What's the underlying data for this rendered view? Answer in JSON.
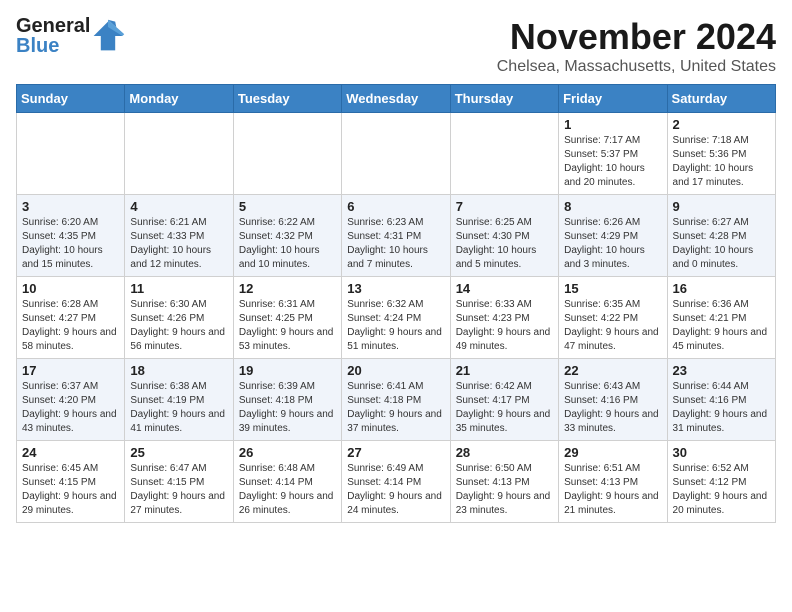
{
  "header": {
    "logo_general": "General",
    "logo_blue": "Blue",
    "month": "November 2024",
    "location": "Chelsea, Massachusetts, United States"
  },
  "days_of_week": [
    "Sunday",
    "Monday",
    "Tuesday",
    "Wednesday",
    "Thursday",
    "Friday",
    "Saturday"
  ],
  "weeks": [
    [
      {
        "day": "",
        "info": ""
      },
      {
        "day": "",
        "info": ""
      },
      {
        "day": "",
        "info": ""
      },
      {
        "day": "",
        "info": ""
      },
      {
        "day": "",
        "info": ""
      },
      {
        "day": "1",
        "info": "Sunrise: 7:17 AM\nSunset: 5:37 PM\nDaylight: 10 hours and 20 minutes."
      },
      {
        "day": "2",
        "info": "Sunrise: 7:18 AM\nSunset: 5:36 PM\nDaylight: 10 hours and 17 minutes."
      }
    ],
    [
      {
        "day": "3",
        "info": "Sunrise: 6:20 AM\nSunset: 4:35 PM\nDaylight: 10 hours and 15 minutes."
      },
      {
        "day": "4",
        "info": "Sunrise: 6:21 AM\nSunset: 4:33 PM\nDaylight: 10 hours and 12 minutes."
      },
      {
        "day": "5",
        "info": "Sunrise: 6:22 AM\nSunset: 4:32 PM\nDaylight: 10 hours and 10 minutes."
      },
      {
        "day": "6",
        "info": "Sunrise: 6:23 AM\nSunset: 4:31 PM\nDaylight: 10 hours and 7 minutes."
      },
      {
        "day": "7",
        "info": "Sunrise: 6:25 AM\nSunset: 4:30 PM\nDaylight: 10 hours and 5 minutes."
      },
      {
        "day": "8",
        "info": "Sunrise: 6:26 AM\nSunset: 4:29 PM\nDaylight: 10 hours and 3 minutes."
      },
      {
        "day": "9",
        "info": "Sunrise: 6:27 AM\nSunset: 4:28 PM\nDaylight: 10 hours and 0 minutes."
      }
    ],
    [
      {
        "day": "10",
        "info": "Sunrise: 6:28 AM\nSunset: 4:27 PM\nDaylight: 9 hours and 58 minutes."
      },
      {
        "day": "11",
        "info": "Sunrise: 6:30 AM\nSunset: 4:26 PM\nDaylight: 9 hours and 56 minutes."
      },
      {
        "day": "12",
        "info": "Sunrise: 6:31 AM\nSunset: 4:25 PM\nDaylight: 9 hours and 53 minutes."
      },
      {
        "day": "13",
        "info": "Sunrise: 6:32 AM\nSunset: 4:24 PM\nDaylight: 9 hours and 51 minutes."
      },
      {
        "day": "14",
        "info": "Sunrise: 6:33 AM\nSunset: 4:23 PM\nDaylight: 9 hours and 49 minutes."
      },
      {
        "day": "15",
        "info": "Sunrise: 6:35 AM\nSunset: 4:22 PM\nDaylight: 9 hours and 47 minutes."
      },
      {
        "day": "16",
        "info": "Sunrise: 6:36 AM\nSunset: 4:21 PM\nDaylight: 9 hours and 45 minutes."
      }
    ],
    [
      {
        "day": "17",
        "info": "Sunrise: 6:37 AM\nSunset: 4:20 PM\nDaylight: 9 hours and 43 minutes."
      },
      {
        "day": "18",
        "info": "Sunrise: 6:38 AM\nSunset: 4:19 PM\nDaylight: 9 hours and 41 minutes."
      },
      {
        "day": "19",
        "info": "Sunrise: 6:39 AM\nSunset: 4:18 PM\nDaylight: 9 hours and 39 minutes."
      },
      {
        "day": "20",
        "info": "Sunrise: 6:41 AM\nSunset: 4:18 PM\nDaylight: 9 hours and 37 minutes."
      },
      {
        "day": "21",
        "info": "Sunrise: 6:42 AM\nSunset: 4:17 PM\nDaylight: 9 hours and 35 minutes."
      },
      {
        "day": "22",
        "info": "Sunrise: 6:43 AM\nSunset: 4:16 PM\nDaylight: 9 hours and 33 minutes."
      },
      {
        "day": "23",
        "info": "Sunrise: 6:44 AM\nSunset: 4:16 PM\nDaylight: 9 hours and 31 minutes."
      }
    ],
    [
      {
        "day": "24",
        "info": "Sunrise: 6:45 AM\nSunset: 4:15 PM\nDaylight: 9 hours and 29 minutes."
      },
      {
        "day": "25",
        "info": "Sunrise: 6:47 AM\nSunset: 4:15 PM\nDaylight: 9 hours and 27 minutes."
      },
      {
        "day": "26",
        "info": "Sunrise: 6:48 AM\nSunset: 4:14 PM\nDaylight: 9 hours and 26 minutes."
      },
      {
        "day": "27",
        "info": "Sunrise: 6:49 AM\nSunset: 4:14 PM\nDaylight: 9 hours and 24 minutes."
      },
      {
        "day": "28",
        "info": "Sunrise: 6:50 AM\nSunset: 4:13 PM\nDaylight: 9 hours and 23 minutes."
      },
      {
        "day": "29",
        "info": "Sunrise: 6:51 AM\nSunset: 4:13 PM\nDaylight: 9 hours and 21 minutes."
      },
      {
        "day": "30",
        "info": "Sunrise: 6:52 AM\nSunset: 4:12 PM\nDaylight: 9 hours and 20 minutes."
      }
    ]
  ]
}
